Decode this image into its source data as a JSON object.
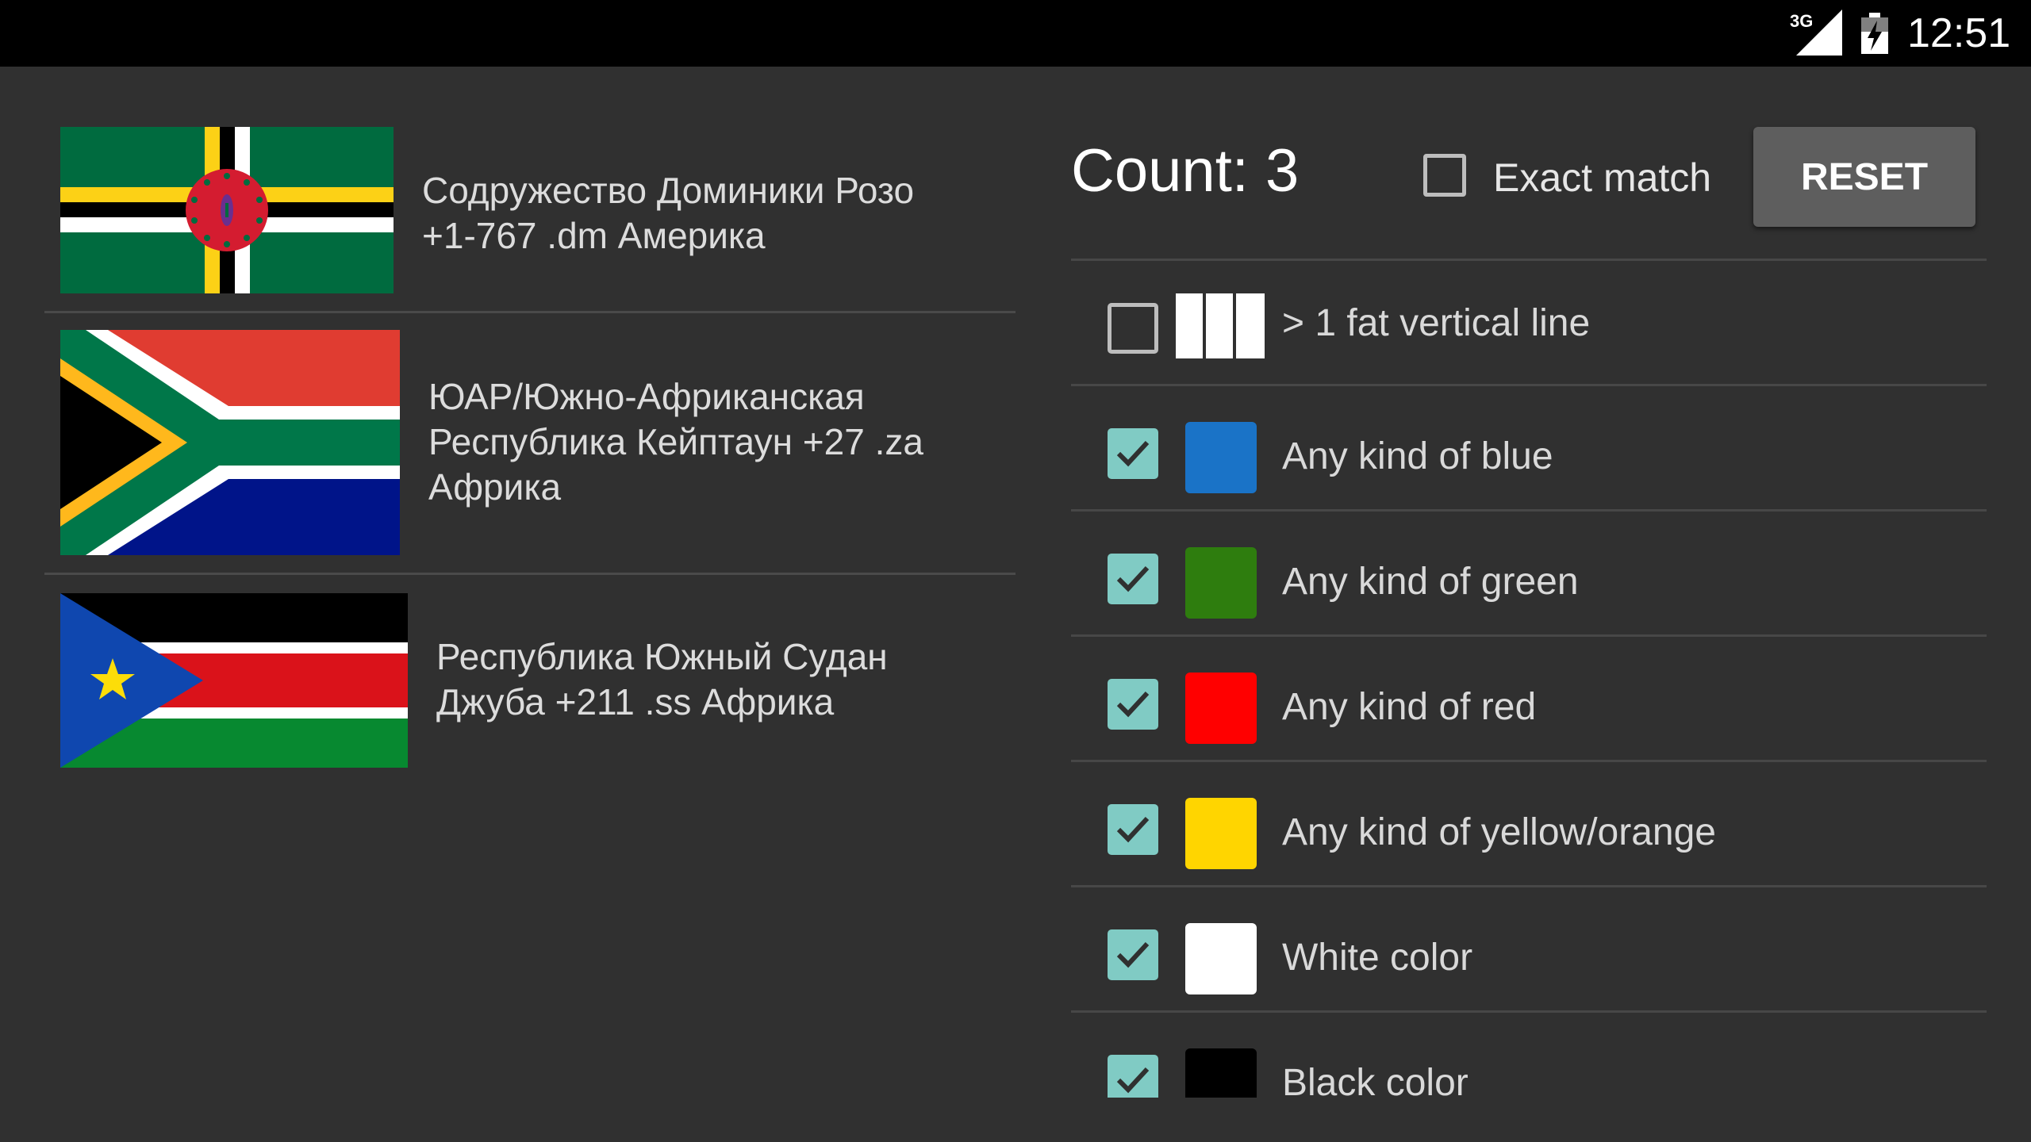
{
  "status_bar": {
    "network_label": "3G",
    "time": "12:51"
  },
  "flags": [
    {
      "country": "dominica",
      "caption_line1": "Содружество Доминики Розо",
      "caption_line2": "+1-767 .dm Америка"
    },
    {
      "country": "south-africa",
      "caption_line1": "ЮАР/Южно-Африканская",
      "caption_line2": "Республика Кейптаун +27 .za",
      "caption_line3": "Африка"
    },
    {
      "country": "south-sudan",
      "caption_line1": "Республика Южный Судан",
      "caption_line2": "Джуба +211 .ss Африка"
    }
  ],
  "filters_panel": {
    "count_label": "Count: 3",
    "exact_match_label": "Exact match",
    "exact_match_checked": false,
    "reset_label": "RESET"
  },
  "filters": [
    {
      "label": "> 1 fat vertical line",
      "checked": false,
      "icon": "vertical-bars-icon"
    },
    {
      "label": "Any kind of blue",
      "checked": true,
      "color": "#1a73c7"
    },
    {
      "label": "Any kind of green",
      "checked": true,
      "color": "#2e7d0e"
    },
    {
      "label": "Any kind of red",
      "checked": true,
      "color": "#ff0000"
    },
    {
      "label": "Any kind of yellow/orange",
      "checked": true,
      "color": "#ffd500"
    },
    {
      "label": "White color",
      "checked": true,
      "color": "#ffffff"
    },
    {
      "label": "Black color",
      "checked": true,
      "color": "#000000"
    }
  ],
  "colors": {
    "background": "#303030",
    "accent_checkbox": "#80cbc4",
    "button": "#5e5e5e"
  }
}
